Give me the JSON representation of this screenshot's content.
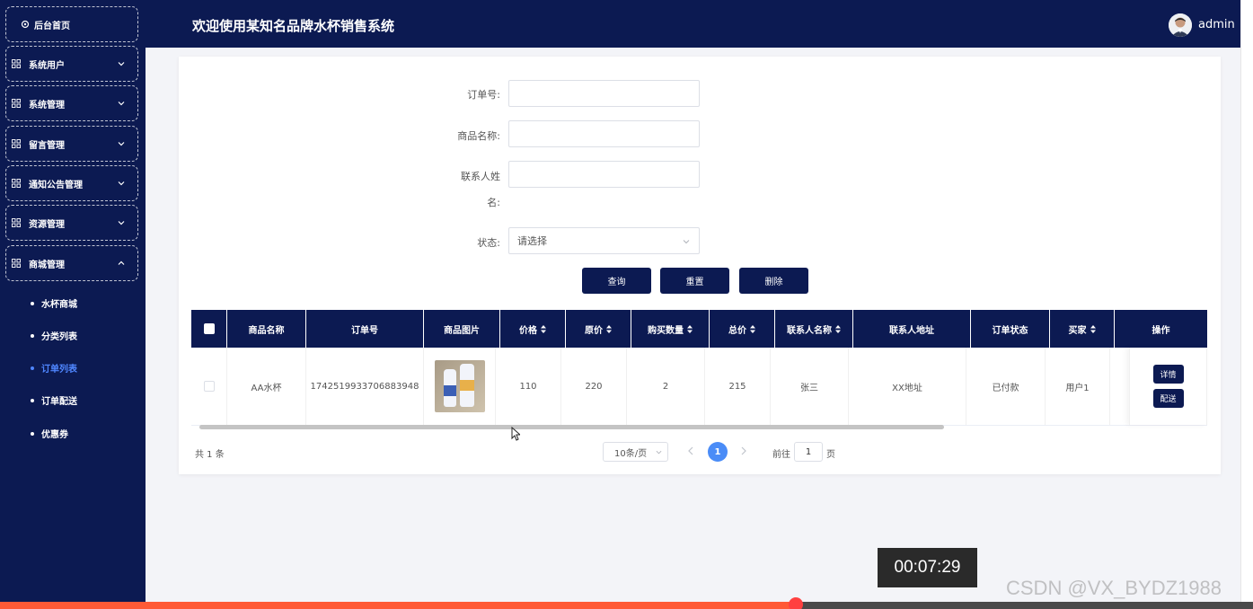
{
  "app": {
    "title": "欢迎使用某知名品牌水杯销售系统",
    "username": "admin"
  },
  "sidebar": {
    "home": "后台首页",
    "menus": [
      {
        "label": "系统用户"
      },
      {
        "label": "系统管理"
      },
      {
        "label": "留言管理"
      },
      {
        "label": "通知公告管理"
      },
      {
        "label": "资源管理"
      },
      {
        "label": "商城管理"
      }
    ],
    "submenu": [
      {
        "label": "水杯商城"
      },
      {
        "label": "分类列表"
      },
      {
        "label": "订单列表"
      },
      {
        "label": "订单配送"
      },
      {
        "label": "优惠券"
      }
    ],
    "active_submenu": "订单列表"
  },
  "search": {
    "order_no_label": "订单号:",
    "order_no_value": "",
    "product_name_label": "商品名称:",
    "product_name_value": "",
    "contact_label_line1": "联系人姓",
    "contact_label_line2": "名:",
    "contact_value": "",
    "status_label": "状态:",
    "status_placeholder": "请选择"
  },
  "buttons": {
    "query": "查询",
    "reset": "重置",
    "delete": "删除"
  },
  "table": {
    "columns": [
      "商品名称",
      "订单号",
      "商品图片",
      "价格",
      "原价",
      "购买数量",
      "总价",
      "联系人名称",
      "联系人地址",
      "订单状态",
      "买家",
      "操作"
    ],
    "rows": [
      {
        "product_name": "AA水杯",
        "order_no": "1742519933706883948",
        "price": "110",
        "original_price": "220",
        "quantity": "2",
        "total": "215",
        "contact_name": "张三",
        "contact_address": "XX地址",
        "status": "已付款",
        "buyer": "用户1",
        "actions": [
          "详情",
          "配送"
        ]
      }
    ]
  },
  "pagination": {
    "total": "共 1 条",
    "page_size": "10条/页",
    "current_page": "1",
    "goto_label": "前往",
    "goto_value": "1",
    "goto_suffix": "页"
  },
  "video": {
    "timestamp": "00:07:29",
    "progress": 0.635,
    "watermark": "CSDN @VX_BYDZ1988"
  },
  "colors": {
    "navy": "#0c1a52",
    "accent": "#4a8cf7",
    "active_submenu": "#4f86ff",
    "progress": "#ff5a36"
  }
}
